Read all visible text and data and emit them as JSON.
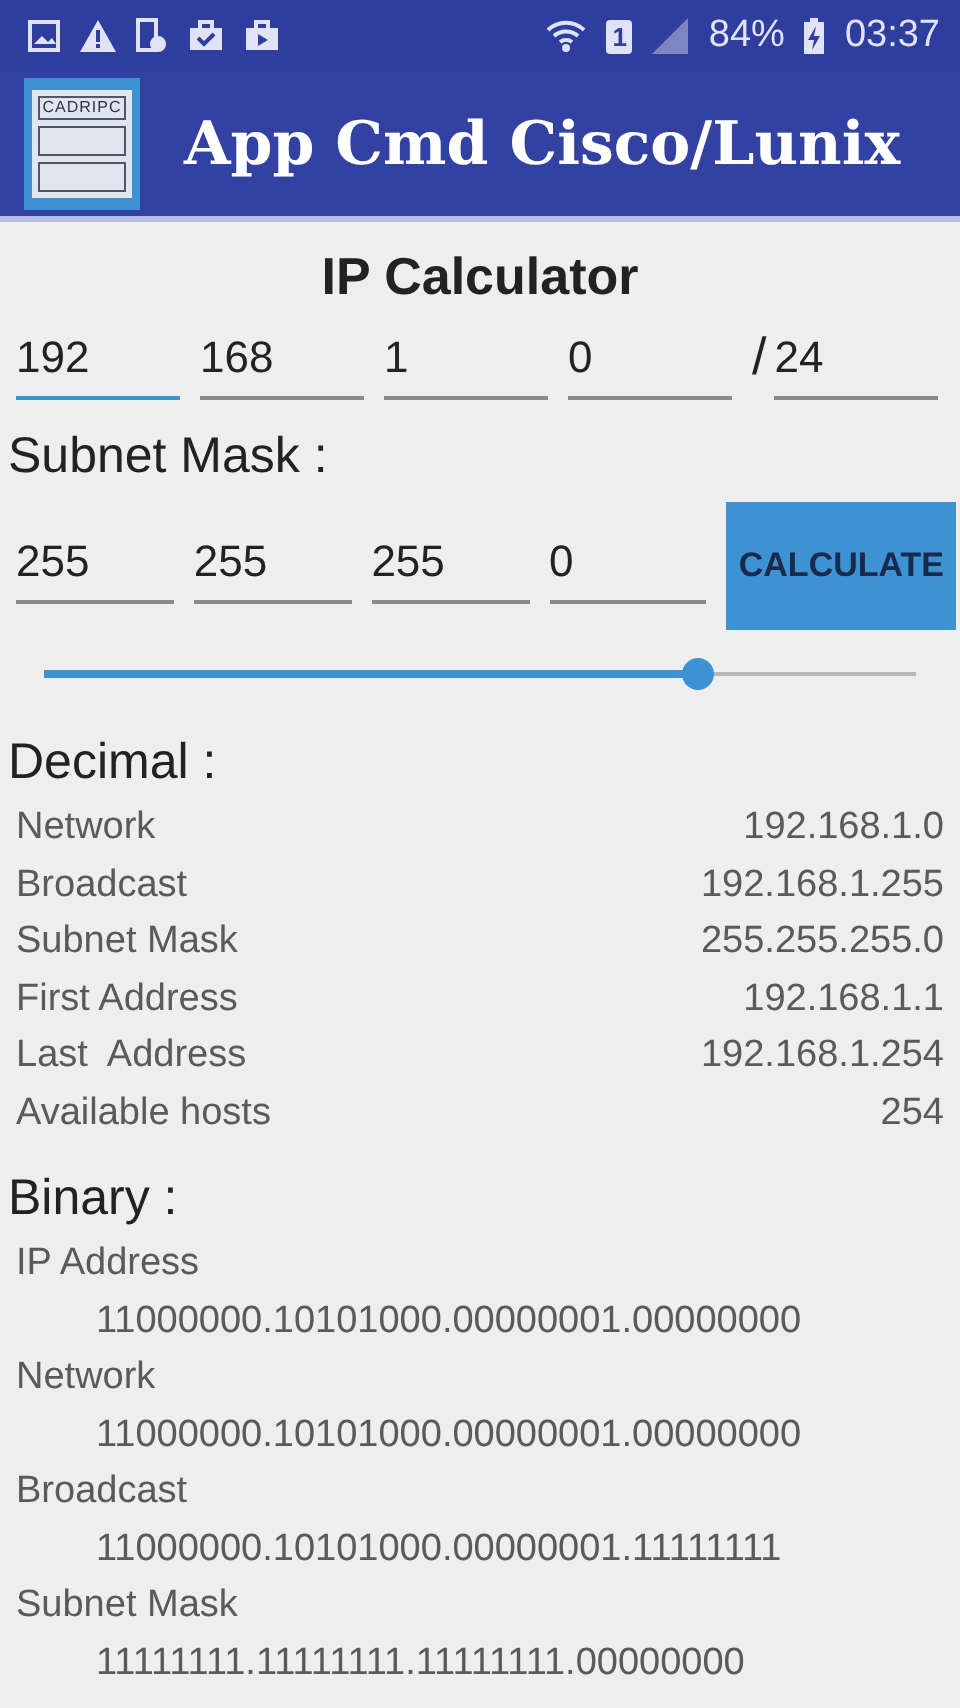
{
  "status_bar": {
    "sim_slot": "1",
    "battery": "84%",
    "time": "03:37"
  },
  "app_bar": {
    "logo_text": "CADRIPC",
    "title": "App Cmd Cisco/Lunix"
  },
  "calculator": {
    "title": "IP Calculator",
    "ip_fields": [
      {
        "value": "192",
        "focused": true
      },
      {
        "value": "168",
        "focused": false
      },
      {
        "value": "1",
        "focused": false
      },
      {
        "value": "0",
        "focused": false
      }
    ],
    "prefix_separator": "/",
    "prefix": "24",
    "mask_label": "Subnet Mask :",
    "mask_fields": [
      "255",
      "255",
      "255",
      "0"
    ],
    "calculate_button": "CALCULATE",
    "prefix_slider": {
      "level": 0.75
    }
  },
  "decimal": {
    "title": "Decimal :",
    "rows": [
      {
        "label": "Network",
        "value": "192.168.1.0"
      },
      {
        "label": "Broadcast",
        "value": "192.168.1.255"
      },
      {
        "label": "Subnet Mask",
        "value": "255.255.255.0"
      },
      {
        "label": "First Address",
        "value": "192.168.1.1"
      },
      {
        "label": "Last  Address",
        "value": "192.168.1.254"
      },
      {
        "label": "Available hosts",
        "value": "254"
      }
    ]
  },
  "binary": {
    "title": "Binary :",
    "rows": [
      {
        "label": "IP Address",
        "value": "11000000.10101000.00000001.00000000"
      },
      {
        "label": "Network",
        "value": "11000000.10101000.00000001.00000000"
      },
      {
        "label": "Broadcast",
        "value": "11000000.10101000.00000001.11111111"
      },
      {
        "label": "Subnet Mask",
        "value": "11111111.11111111.11111111.00000000"
      }
    ]
  }
}
